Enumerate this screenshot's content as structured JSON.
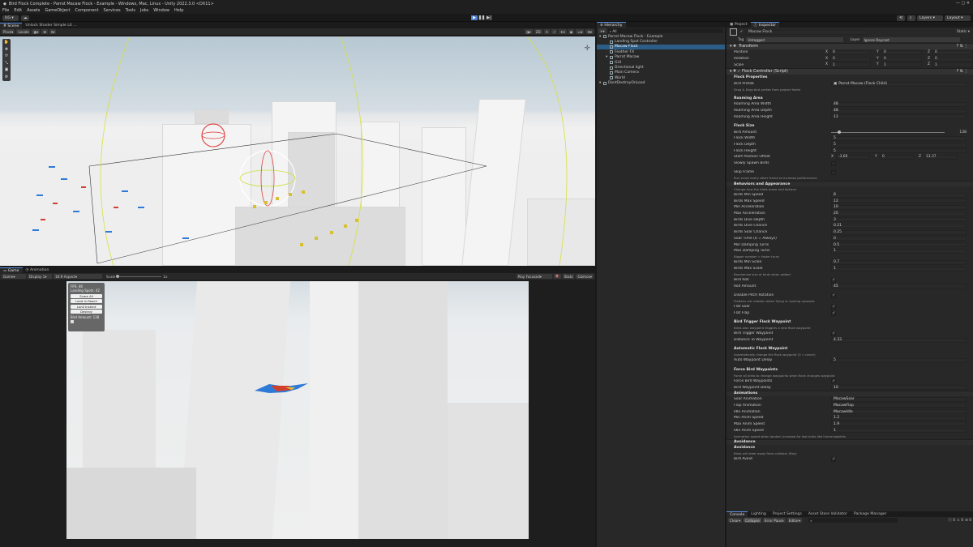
{
  "window": {
    "title": "Bird Flock Complete - Parrot Macaw Flock - Example - Windows, Mac, Linux - Unity 2022.3.0 <DX11>"
  },
  "menu": [
    "File",
    "Edit",
    "Assets",
    "GameObject",
    "Component",
    "Services",
    "Tools",
    "Jobs",
    "Window",
    "Help"
  ],
  "toolbar": {
    "account": "UG",
    "layers": "Layers",
    "layout": "Layout"
  },
  "scene": {
    "tabs": [
      "Scene",
      "Unlock Shader Simple Lit ..."
    ],
    "pivot": "Pivot",
    "local": "Local",
    "mode_2d": "2D"
  },
  "game": {
    "tabs": [
      "Game",
      "Animation"
    ],
    "mode": "Game",
    "display": "Display 1",
    "aspect": "16:9 Aspect",
    "scale_label": "Scale",
    "scale_value": "1x",
    "play_focused": "Play Focused",
    "stats": "Stats",
    "gizmos": "Gizmos",
    "overlay": {
      "fps": "FPS: 46",
      "landing": "Landing Spots: 42",
      "btn1": "Scare All",
      "btn2": "Land In Reach",
      "btn3": "Land Instant",
      "btn4": "Destroy",
      "amount": "Bird Amount: 138"
    }
  },
  "hierarchy": {
    "tab": "Hierarchy",
    "search": "All",
    "items": [
      {
        "label": "Parrot Macaw Flock - Example",
        "indent": 0
      },
      {
        "label": "Landing Spot Controller",
        "indent": 1
      },
      {
        "label": "Macaw Flock",
        "indent": 1,
        "selected": true
      },
      {
        "label": "Feather FX",
        "indent": 1
      },
      {
        "label": "Parrot Macaw",
        "indent": 1
      },
      {
        "label": "GUI",
        "indent": 1
      },
      {
        "label": "Directional light",
        "indent": 1
      },
      {
        "label": "Main Camera",
        "indent": 1
      },
      {
        "label": "World",
        "indent": 1
      },
      {
        "label": "DontDestroyOnLoad",
        "indent": 0
      }
    ]
  },
  "inspector": {
    "tabs": [
      "Project",
      "Inspector"
    ],
    "object": "Macaw Flock",
    "static": "Static",
    "tag_label": "Tag",
    "tag": "Untagged",
    "layer_label": "Layer",
    "layer": "Ignore Raycast",
    "transform": {
      "title": "Transform",
      "position": [
        "0",
        "0",
        "0"
      ],
      "rotation": [
        "0",
        "0",
        "0"
      ],
      "scale": [
        "1",
        "1",
        "1"
      ],
      "labels": [
        "Position",
        "Rotation",
        "Scale"
      ]
    },
    "script_title": "Flock Controller (Script)",
    "rows": [
      {
        "t": "head",
        "l": "Flock Properties"
      },
      {
        "l": "Bird Prefab",
        "v": "Parrot Macaw (Flock Child)"
      },
      {
        "t": "help",
        "l": "Drag & Drop bird prefab from project folder"
      },
      {
        "t": "gap"
      },
      {
        "t": "head",
        "l": "Roaming Area"
      },
      {
        "l": "Roaming Area Width",
        "v": "48"
      },
      {
        "l": "Roaming Area Depth",
        "v": "48"
      },
      {
        "l": "Roaming Area Height",
        "v": "11"
      },
      {
        "t": "gap"
      },
      {
        "t": "head",
        "l": "Flock Size"
      },
      {
        "t": "slider",
        "l": "Bird Amount",
        "v": "138"
      },
      {
        "l": "Flock Width",
        "v": "5"
      },
      {
        "l": "Flock Depth",
        "v": "5"
      },
      {
        "l": "Flock Height",
        "v": "5"
      },
      {
        "t": "xyz",
        "l": "Start Position Offset",
        "v": [
          "-3.66",
          "0",
          "13.37"
        ]
      },
      {
        "l": "Slowly Spawn Birds",
        "v": ""
      },
      {
        "t": "gap"
      },
      {
        "l": "Skip Frame",
        "v": ""
      },
      {
        "t": "help",
        "l": "Run script every other frame to increase performance"
      },
      {
        "t": "sec",
        "l": "Behaviors and Appearance"
      },
      {
        "t": "help",
        "l": "Change how the birds move and behave"
      },
      {
        "l": "Birds Min Speed",
        "v": "8"
      },
      {
        "l": "Birds Max Speed",
        "v": "12"
      },
      {
        "l": "Min Acceleration",
        "v": "10"
      },
      {
        "l": "Max Acceleration",
        "v": "20"
      },
      {
        "l": "Birds Dive Depth",
        "v": "3"
      },
      {
        "l": "Birds Dive Chance",
        "v": "0.21"
      },
      {
        "l": "Birds Soar Chance",
        "v": "0.25"
      },
      {
        "l": "Soar Time (0 = Always)",
        "v": "0"
      },
      {
        "l": "Min Damping Turns",
        "v": "0.5"
      },
      {
        "l": "Max Damping Turns",
        "v": "1"
      },
      {
        "t": "help",
        "l": "Bigger number = faster turns"
      },
      {
        "l": "Birds Min Scale",
        "v": "0.7"
      },
      {
        "l": "Birds Max Scale",
        "v": "1"
      },
      {
        "t": "help",
        "l": "Randomize size of birds when added"
      },
      {
        "l": "Bird Roll",
        "v": "✓"
      },
      {
        "l": "Roll Amount",
        "v": "45"
      },
      {
        "t": "gap"
      },
      {
        "l": "Disable Pitch Rotation",
        "v": "✓"
      },
      {
        "t": "help",
        "l": "Flattens out rotation when flying or soaring upwards"
      },
      {
        "l": "Flat Soar",
        "v": "✓"
      },
      {
        "l": "Flat Flap",
        "v": "✓"
      },
      {
        "t": "gap"
      },
      {
        "t": "head",
        "l": "Bird Trigger Flock Waypoint"
      },
      {
        "t": "help",
        "l": "Birds own waypoint triggers a new flock waypoint"
      },
      {
        "l": "Bird Trigger Waypoint",
        "v": "✓"
      },
      {
        "l": "Distance To Waypoint",
        "v": "4.33"
      },
      {
        "t": "gap"
      },
      {
        "t": "head",
        "l": "Automatic Flock Waypoint"
      },
      {
        "t": "help",
        "l": "Automatically change the flock waypoint (0 = never)"
      },
      {
        "l": "Auto Waypoint Delay",
        "v": "5"
      },
      {
        "t": "gap"
      },
      {
        "t": "head",
        "l": "Force Bird Waypoints"
      },
      {
        "t": "help",
        "l": "Force all birds to change waypoints when flock changes waypoint"
      },
      {
        "l": "Force Bird Waypoints",
        "v": "✓"
      },
      {
        "l": "Bird Waypoint Delay",
        "v": "10"
      },
      {
        "t": "sec",
        "l": "Animations"
      },
      {
        "l": "Soar Animation",
        "v": "MacawSoar"
      },
      {
        "l": "Flap Animation",
        "v": "MacawFlap"
      },
      {
        "l": "Idle Animation",
        "v": "MacawIdle"
      },
      {
        "l": "Min Anim Speed",
        "v": "1.2"
      },
      {
        "l": "Max Anim Speed",
        "v": "1.9"
      },
      {
        "l": "Idle Anim Speed",
        "v": "1"
      },
      {
        "t": "help",
        "l": "Animation speed when landed. Increase for fast birds like hummingbirds"
      },
      {
        "t": "sec",
        "l": "Avoidance"
      },
      {
        "t": "head",
        "l": "Avoidance"
      },
      {
        "t": "help",
        "l": "Birds will steer away from colliders (Ray)"
      },
      {
        "l": "Bird Avoid",
        "v": "✓"
      }
    ]
  },
  "console": {
    "tabs": [
      "Console",
      "Lighting",
      "Project Settings",
      "Asset Store Validator",
      "Package Manager"
    ],
    "clear": "Clear",
    "collapse": "Collapse",
    "error_pause": "Error Pause",
    "editor": "Editor",
    "counts": [
      "0",
      "0",
      "0"
    ]
  }
}
